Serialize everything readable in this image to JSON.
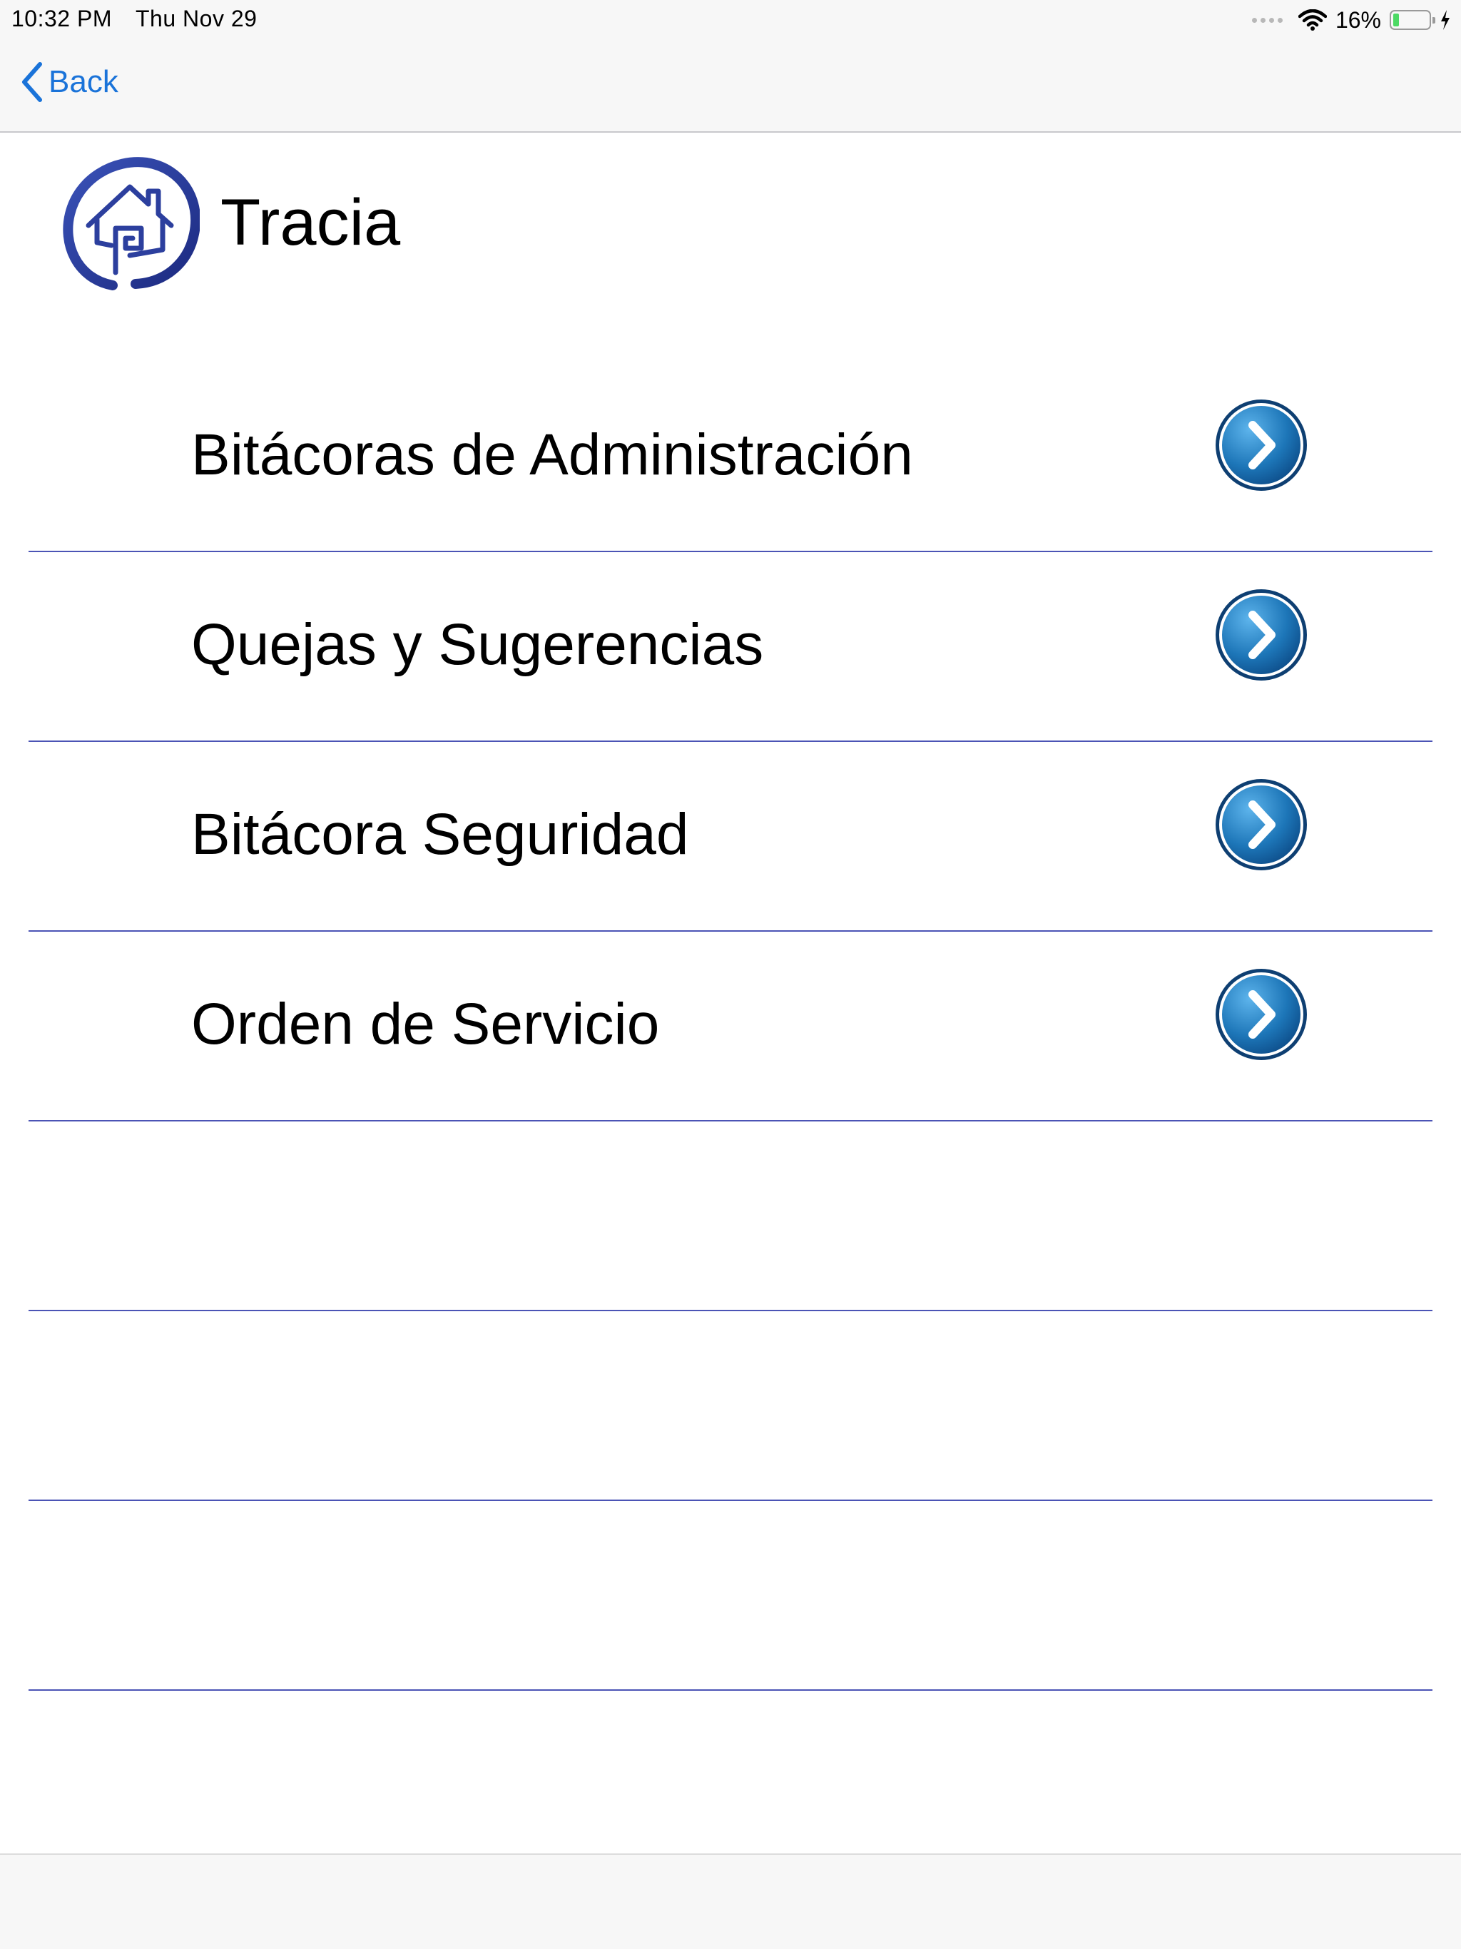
{
  "status_bar": {
    "time": "10:32 PM",
    "date": "Thu Nov 29",
    "battery_percent": "16%",
    "battery_level": 0.16,
    "battery_color": "#4cd964"
  },
  "nav": {
    "back_label": "Back",
    "accent_color": "#1a73d9"
  },
  "header": {
    "title": "Tracia",
    "logo_icon": "house-logo-icon"
  },
  "menu": {
    "divider_color": "#4b54b5",
    "items": [
      {
        "label": "Bitácoras de Administración",
        "icon": "chevron-right-circle-icon"
      },
      {
        "label": "Quejas y Sugerencias",
        "icon": "chevron-right-circle-icon"
      },
      {
        "label": "Bitácora Seguridad",
        "icon": "chevron-right-circle-icon"
      },
      {
        "label": "Orden de Servicio",
        "icon": "chevron-right-circle-icon"
      }
    ],
    "empty_rows": 3
  }
}
